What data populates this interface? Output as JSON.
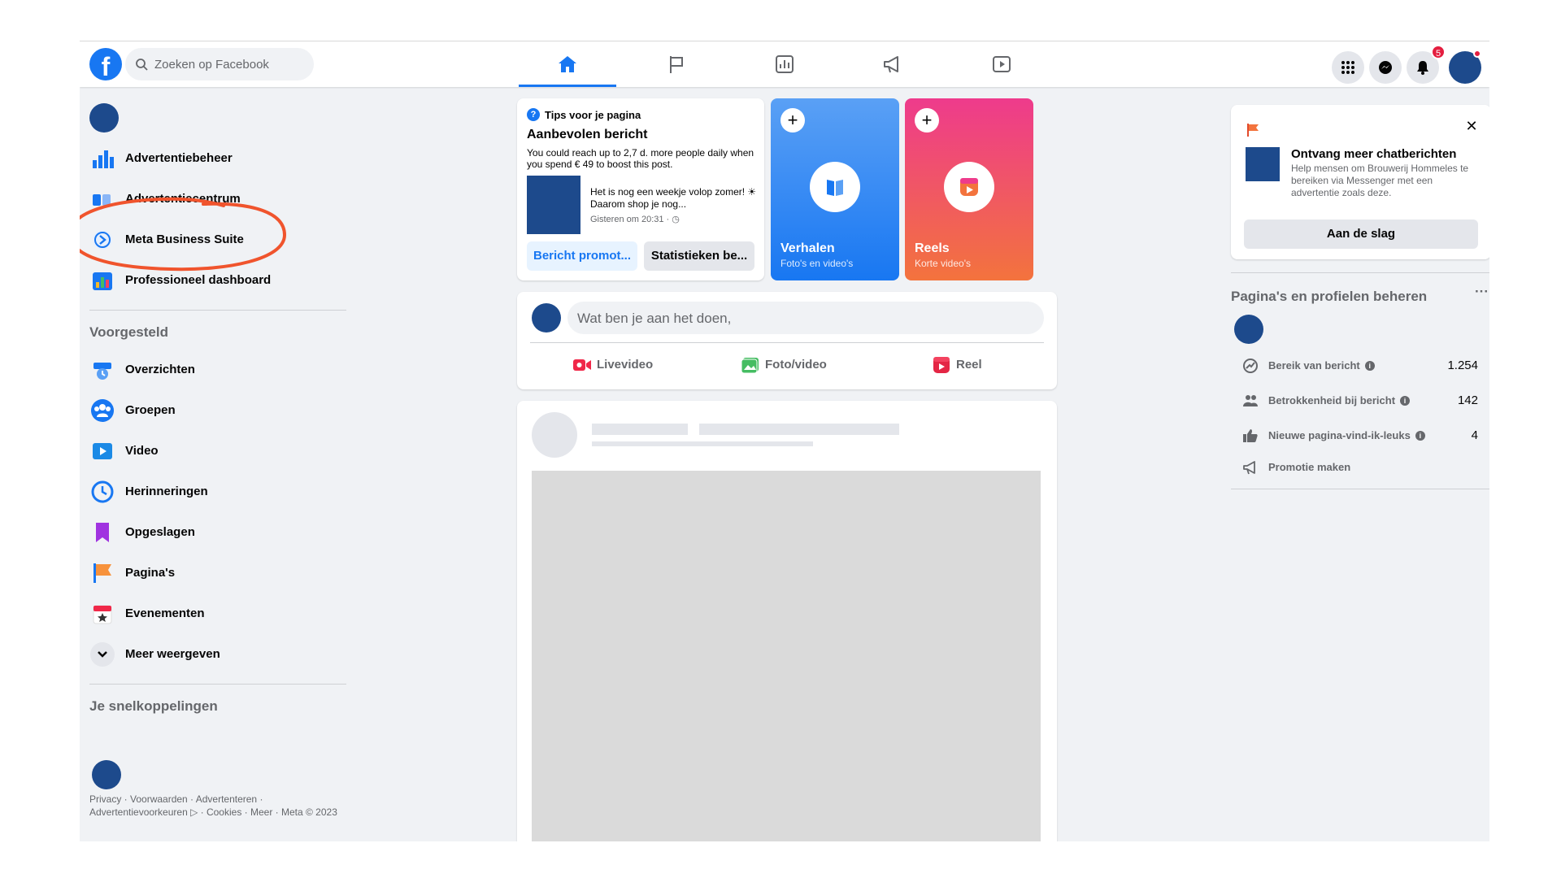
{
  "topbar": {
    "search_placeholder": "Zoeken op Facebook",
    "nav_tabs": [
      {
        "name": "home",
        "active": true
      },
      {
        "name": "pages"
      },
      {
        "name": "insights"
      },
      {
        "name": "ads"
      },
      {
        "name": "watch"
      }
    ],
    "notification_count": "5"
  },
  "leftnav": {
    "items_top": [
      {
        "label": "Advertentiebeheer",
        "icon": "bar-chart-icon"
      },
      {
        "label": "Advertentiecentrum",
        "icon": "ad-center-icon"
      },
      {
        "label": "Meta Business Suite",
        "icon": "meta-business-suite-icon"
      },
      {
        "label": "Professioneel dashboard",
        "icon": "dashboard-icon"
      }
    ],
    "suggested_heading": "Voorgesteld",
    "items_suggested": [
      {
        "label": "Overzichten",
        "icon": "overviews-icon"
      },
      {
        "label": "Groepen",
        "icon": "groups-icon"
      },
      {
        "label": "Video",
        "icon": "video-icon"
      },
      {
        "label": "Herinneringen",
        "icon": "memories-icon"
      },
      {
        "label": "Opgeslagen",
        "icon": "saved-icon"
      },
      {
        "label": "Pagina's",
        "icon": "pages-flag-icon"
      },
      {
        "label": "Evenementen",
        "icon": "events-icon"
      },
      {
        "label": "Meer weergeven",
        "icon": "chevron-down-icon"
      }
    ],
    "shortcuts_heading": "Je snelkoppelingen",
    "footer": "Privacy · Voorwaarden · Advertenteren · Advertentievoorkeuren ▷ · Cookies · Meer · Meta © 2023"
  },
  "tips": {
    "label": "Tips voor je pagina",
    "title": "Aanbevolen bericht",
    "description": "You could reach up to 2,7 d. more people daily when you spend € 49 to boost this post.",
    "post_text": "Het is nog een weekje volop zomer! ☀ Daarom shop je nog...",
    "post_date": "Gisteren om 20:31 · ◷",
    "promote_button": "Bericht promot...",
    "stats_button": "Statistieken be..."
  },
  "stories": {
    "title": "Verhalen",
    "subtitle": "Foto's en video's"
  },
  "reels": {
    "title": "Reels",
    "subtitle": "Korte video's"
  },
  "composer": {
    "placeholder": "Wat ben je aan het doen,",
    "actions": [
      {
        "label": "Livevideo",
        "color": "#f02849"
      },
      {
        "label": "Foto/video",
        "color": "#45bd62"
      },
      {
        "label": "Reel",
        "color": "#e42645"
      }
    ]
  },
  "chat_card": {
    "title": "Ontvang meer chatberichten",
    "description": "Help mensen om Brouwerij Hommeles te bereiken via Messenger met een advertentie zoals deze.",
    "button": "Aan de slag"
  },
  "manage": {
    "title": "Pagina's en profielen beheren",
    "more": "···",
    "rows": [
      {
        "label": "Bereik van bericht",
        "value": "1.254"
      },
      {
        "label": "Betrokkenheid bij bericht",
        "value": "142"
      },
      {
        "label": "Nieuwe pagina-vind-ik-leuks",
        "value": "4"
      },
      {
        "label": "Promotie maken",
        "value": ""
      }
    ]
  },
  "colors": {
    "brand": "#1877f2",
    "annotation": "#f0542d"
  }
}
